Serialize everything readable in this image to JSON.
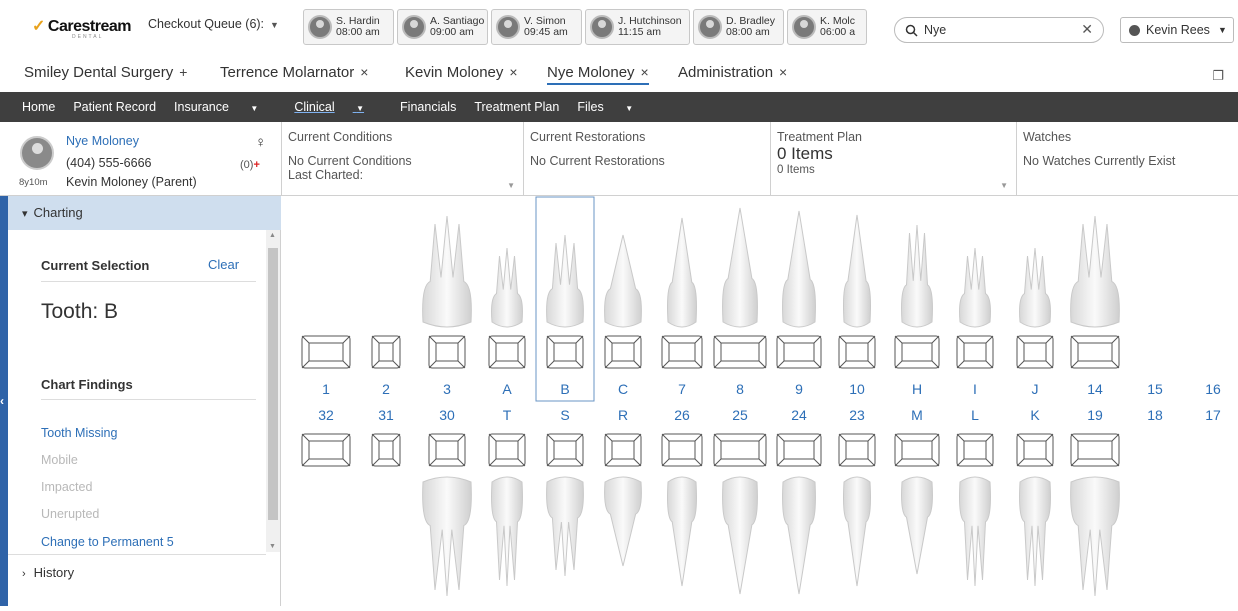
{
  "brand": {
    "name": "Carestream",
    "sub": "DENTAL",
    "accent": "#e8a21c"
  },
  "queue": {
    "label": "Checkout Queue (6):"
  },
  "appointments": [
    {
      "name": "S. Hardin",
      "time": "08:00 am"
    },
    {
      "name": "A. Santiago",
      "time": "09:00 am"
    },
    {
      "name": "V. Simon",
      "time": "09:45 am"
    },
    {
      "name": "J. Hutchinson",
      "time": "11:15 am"
    },
    {
      "name": "D. Bradley",
      "time": "08:00 am"
    },
    {
      "name": "K. Molc",
      "time": "06:00 a"
    }
  ],
  "search": {
    "value": "Nye"
  },
  "user": {
    "name": "Kevin Rees"
  },
  "tabs": [
    {
      "label": "Smiley Dental Surgery",
      "icon": "+"
    },
    {
      "label": "Terrence Molarnator",
      "icon": "×"
    },
    {
      "label": "Kevin Moloney",
      "icon": "×"
    },
    {
      "label": "Nye Moloney",
      "icon": "×",
      "active": true
    },
    {
      "label": "Administration",
      "icon": "×"
    }
  ],
  "nav": {
    "home": "Home",
    "patient_record": "Patient Record",
    "insurance": "Insurance",
    "clinical": "Clinical",
    "financials": "Financials",
    "treatment_plan": "Treatment Plan",
    "files": "Files"
  },
  "patient": {
    "name": "Nye Moloney",
    "phone": "(404) 555-6666",
    "parent": "Kevin Moloney (Parent)",
    "age": "8y10m",
    "alerts": "(0)",
    "gender_symbol": "♀"
  },
  "conditions": {
    "title": "Current Conditions",
    "value": "No Current Conditions",
    "last": "Last Charted:"
  },
  "restorations": {
    "title": "Current Restorations",
    "value": "No Current Restorations"
  },
  "treatment": {
    "title": "Treatment Plan",
    "count": "0 Items",
    "sub": "0 Items"
  },
  "watches": {
    "title": "Watches",
    "value": "No Watches Currently Exist"
  },
  "charting": {
    "header": "Charting",
    "selection_title": "Current Selection",
    "clear": "Clear",
    "tooth": "Tooth: B",
    "findings_title": "Chart Findings",
    "findings": [
      {
        "label": "Tooth Missing",
        "enabled": true
      },
      {
        "label": "Mobile",
        "enabled": false
      },
      {
        "label": "Impacted",
        "enabled": false
      },
      {
        "label": "Unerupted",
        "enabled": false
      },
      {
        "label": "Change to Permanent 5",
        "enabled": true
      }
    ],
    "history": "History"
  },
  "tooth_chart": {
    "upper_labels": [
      "1",
      "2",
      "3",
      "A",
      "B",
      "C",
      "7",
      "8",
      "9",
      "10",
      "H",
      "I",
      "J",
      "14",
      "15",
      "16"
    ],
    "lower_labels": [
      "32",
      "31",
      "30",
      "T",
      "S",
      "R",
      "26",
      "25",
      "24",
      "23",
      "M",
      "L",
      "K",
      "19",
      "18",
      "17"
    ],
    "selected": "B"
  }
}
